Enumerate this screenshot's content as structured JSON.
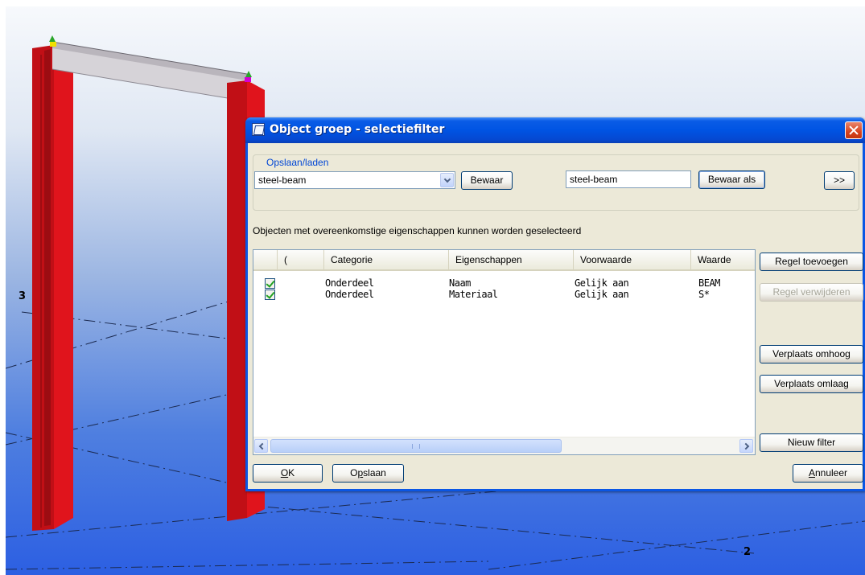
{
  "viewport": {
    "grid_labels": [
      "3",
      "2"
    ],
    "colors": {
      "column": "#d8121a",
      "beam": "#cbc8cd",
      "grid_line": "#1b2a50"
    }
  },
  "dialog": {
    "title": "Object groep - selectiefilter",
    "title_icon": "filter-app-icon",
    "close_icon": "close-icon",
    "save_load": {
      "legend": "Opslaan/laden",
      "filter_select": {
        "value": "steel-beam",
        "icon": "chevron-down-icon"
      },
      "save_button": "Bewaar",
      "save_as_name": "steel-beam",
      "save_as_button": "Bewaar als",
      "expand_button": ">>"
    },
    "info_text": "Objecten met overeenkomstige eigenschappen kunnen worden geselecteerd",
    "table": {
      "columns": [
        "",
        "(",
        "Categorie",
        "Eigenschappen",
        "Voorwaarde",
        "Waarde"
      ],
      "rows": [
        {
          "checked": true,
          "paren": "",
          "categorie": "Onderdeel",
          "eigenschappen": "Naam",
          "voorwaarde": "Gelijk aan",
          "waarde": "BEAM"
        },
        {
          "checked": true,
          "paren": "",
          "categorie": "Onderdeel",
          "eigenschappen": "Materiaal",
          "voorwaarde": "Gelijk aan",
          "waarde": "S*"
        }
      ]
    },
    "side_buttons": {
      "add_row": "Regel toevoegen",
      "remove_row": "Regel verwijderen",
      "move_up": "Verplaats omhoog",
      "move_down": "Verplaats omlaag",
      "new_filter": "Nieuw filter"
    },
    "footer": {
      "ok_mnemonic": "O",
      "ok_rest": "K",
      "save_mnemonic": "p",
      "save_prefix": "O",
      "save_rest": "slaan",
      "cancel_mnemonic": "A",
      "cancel_rest": "nnuleer"
    },
    "colors": {
      "titlebar": "#0054e3",
      "client": "#ece9d8",
      "legend_text": "#0046d5",
      "close_button": "#d7431f"
    }
  }
}
